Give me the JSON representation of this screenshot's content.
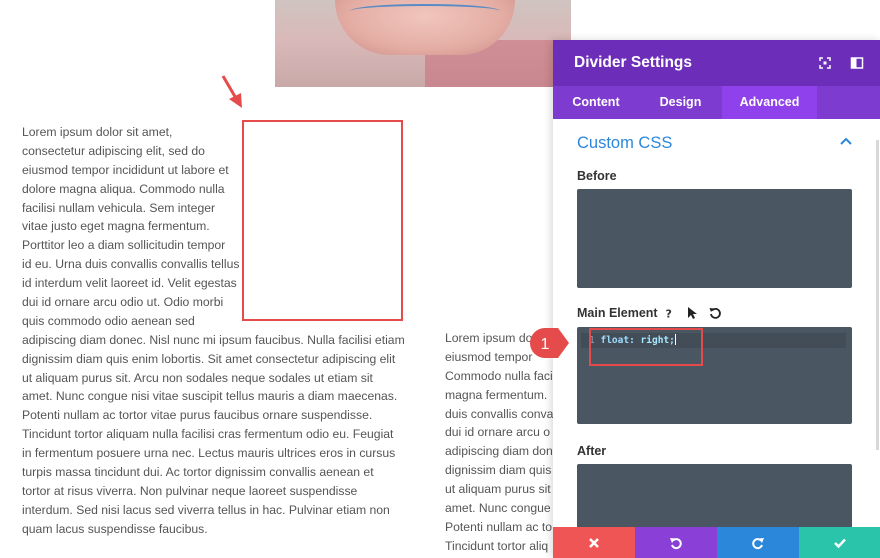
{
  "panel": {
    "title": "Divider Settings",
    "tabs": [
      {
        "label": "Content"
      },
      {
        "label": "Design"
      },
      {
        "label": "Advanced"
      }
    ],
    "section_title": "Custom CSS",
    "fields": {
      "before_label": "Before",
      "main_label": "Main Element",
      "after_label": "After"
    },
    "code": {
      "line_number": "1",
      "property": "float",
      "colon": ":",
      "value": "right",
      "semicolon": ";"
    }
  },
  "annotation": {
    "step": "1"
  },
  "colors": {
    "header": "#6c2eb9",
    "tabs": "#7e3bd0",
    "tab_active": "#8f42ec",
    "accent": "#2b87da",
    "highlight": "#e54b4b",
    "code_bg": "#4b5663",
    "cancel": "#ef5555",
    "undo": "#8a3fd6",
    "redo": "#2b87da",
    "save": "#29c4a9"
  },
  "icons": [
    "fullscreen-icon",
    "sidebar-toggle-icon",
    "chevron-up-icon",
    "help-icon",
    "cursor-icon",
    "reset-icon",
    "close-icon",
    "undo-icon",
    "redo-icon",
    "check-icon"
  ],
  "text_column_1": [
    "Lorem ipsum dolor sit amet,",
    "consectetur adipiscing elit, sed do",
    "eiusmod tempor incididunt ut labore et",
    "dolore magna aliqua. Commodo nulla",
    "facilisi nullam vehicula. Sem integer",
    "vitae justo eget magna fermentum.",
    "Porttitor leo a diam sollicitudin tempor",
    "id eu. Urna duis convallis convallis tellus",
    "id interdum velit laoreet id. Velit egestas",
    "dui id ornare arcu odio ut. Odio morbi",
    "quis commodo odio aenean sed",
    "adipiscing diam donec. Nisl nunc mi ipsum faucibus. Nulla facilisi etiam",
    "dignissim diam quis enim lobortis. Sit amet consectetur adipiscing elit",
    "ut aliquam purus sit. Arcu non sodales neque sodales ut etiam sit",
    "amet. Nunc congue nisi vitae suscipit tellus mauris a diam maecenas.",
    "Potenti nullam ac tortor vitae purus faucibus ornare suspendisse.",
    "Tincidunt tortor aliquam nulla facilisi cras fermentum odio eu. Feugiat",
    "in fermentum posuere urna nec. Lectus mauris ultrices eros in cursus",
    "turpis massa tincidunt dui. Ac tortor dignissim convallis aenean et",
    "tortor at risus viverra. Non pulvinar neque laoreet suspendisse",
    "interdum. Sed nisi lacus sed viverra tellus in hac. Pulvinar etiam non",
    "quam lacus suspendisse faucibus."
  ],
  "text_column_2": [
    "Lorem ipsum do",
    "eiusmod tempor",
    "Commodo nulla faci",
    "magna fermentum.",
    "duis convallis conval",
    "dui id ornare arcu o",
    "adipiscing diam don",
    "dignissim diam quis",
    "ut aliquam purus sit",
    "amet. Nunc congue",
    "Potenti nullam ac to",
    "Tincidunt tortor aliq"
  ]
}
